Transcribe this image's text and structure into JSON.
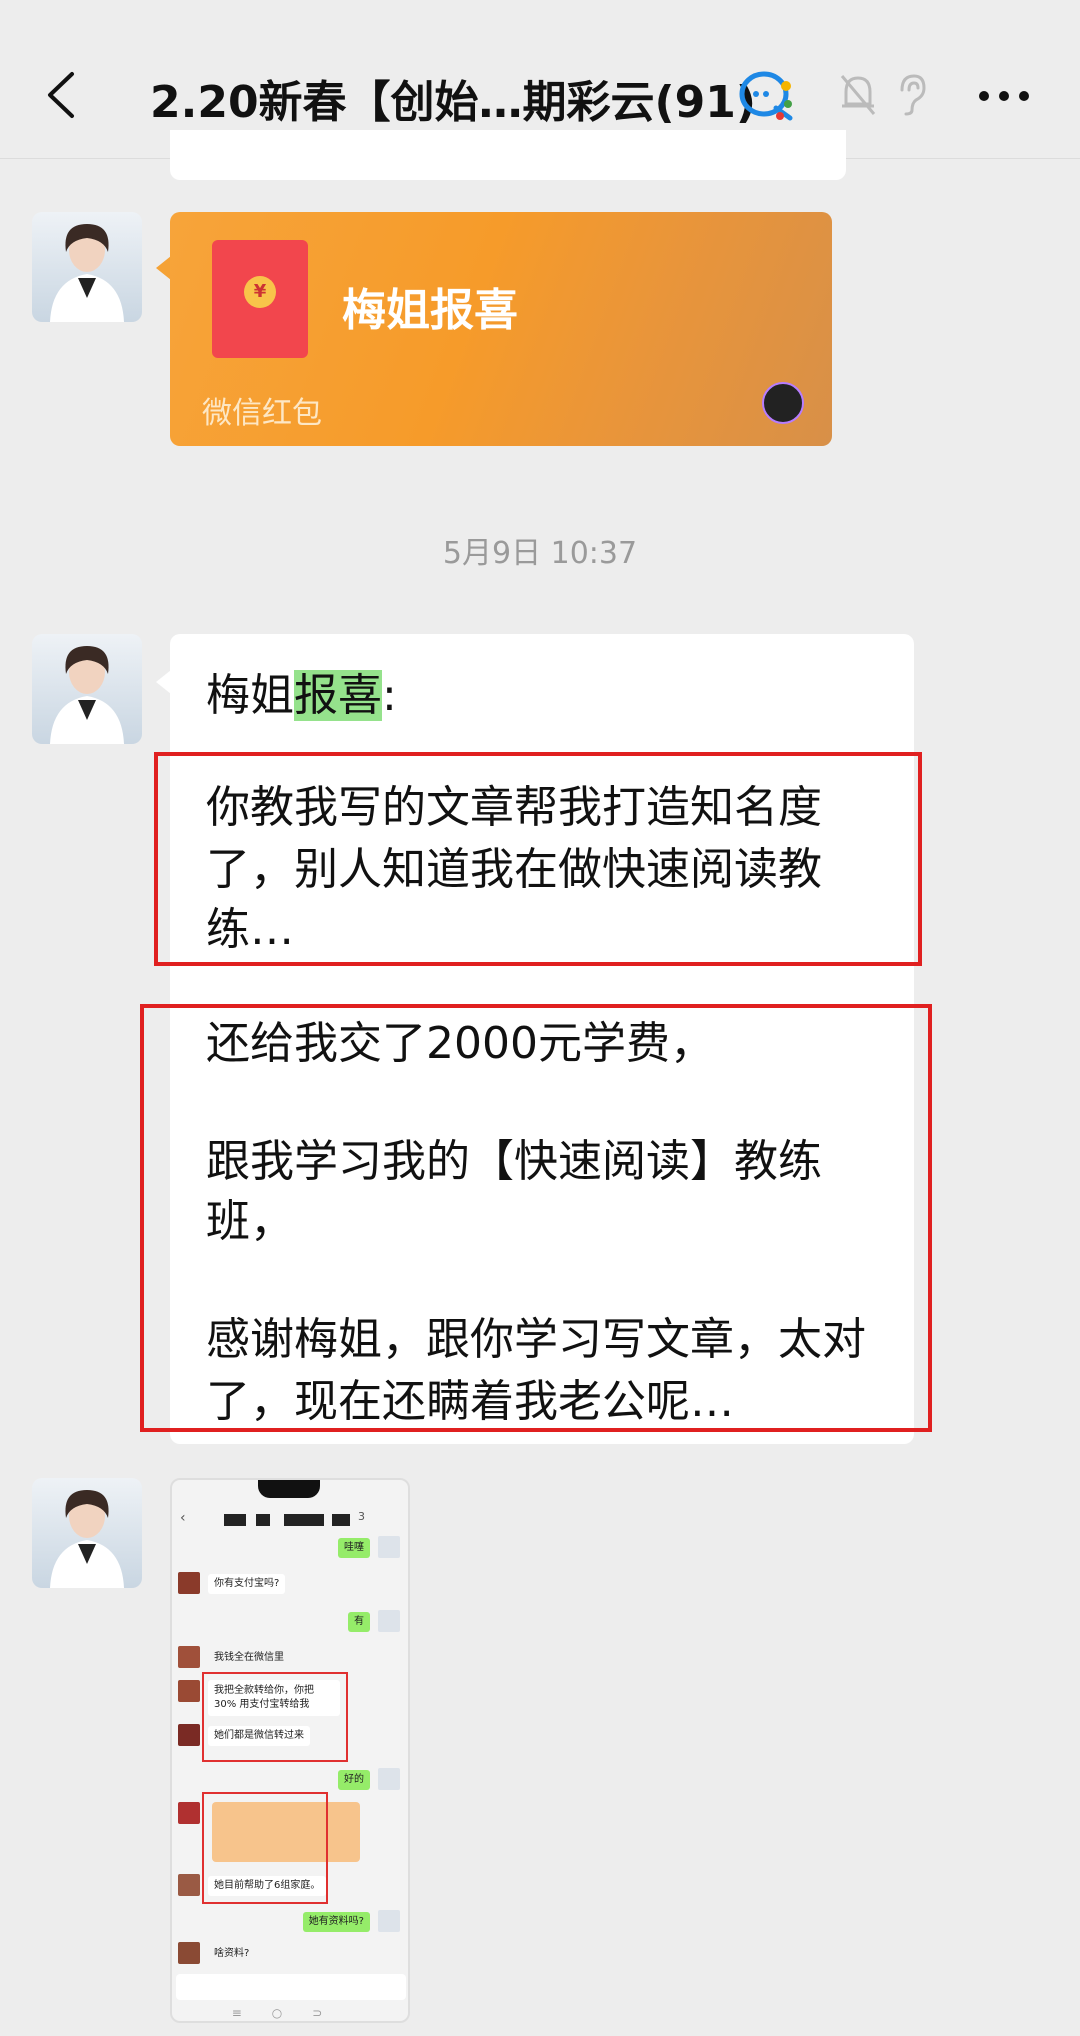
{
  "header": {
    "title": "2.20新春【创始…期彩云(91)",
    "back_icon": "chevron-left-icon",
    "icons": [
      "ai-assistant-icon",
      "mute-bell-icon",
      "ear-icon",
      "more-icon"
    ]
  },
  "red_packet": {
    "title": "梅姐报喜",
    "footer": "微信红包",
    "coin": "¥"
  },
  "timestamp": "5月9日 10:37",
  "text_message": {
    "name": "梅姐",
    "highlight": "报喜",
    "colon": ":",
    "lines": [
      "你教我写的文章帮我打造知名度",
      "了，别人知道我在做快速阅读教",
      "练…",
      "还给我交了2000元学费，",
      "跟我学习我的【快速阅读】教练",
      "班，",
      "感谢梅姐，跟你学习写文章，太对",
      "了，现在还瞒着我老公呢…"
    ]
  },
  "screenshot_message": {
    "top_suffix": "3",
    "bubbles": [
      {
        "side": "right",
        "text": "哇噻"
      },
      {
        "side": "left",
        "text": "你有支付宝吗?"
      },
      {
        "side": "right",
        "text": "有"
      },
      {
        "side": "left",
        "text": "我钱全在微信里"
      },
      {
        "side": "left",
        "text": "我把全款转给你，你把 30% 用支付宝转给我"
      },
      {
        "side": "left",
        "text": "她们都是微信转过来"
      },
      {
        "side": "right",
        "text": "好的"
      },
      {
        "side": "left",
        "text": "她目前帮助了6组家庭。"
      },
      {
        "side": "right",
        "text": "她有资料吗?"
      },
      {
        "side": "left",
        "text": "啥资料?"
      }
    ]
  },
  "colors": {
    "background": "#ededed",
    "red_packet": "#f7a43a",
    "highlight": "#95e28c",
    "annotation_red": "#e02020"
  }
}
